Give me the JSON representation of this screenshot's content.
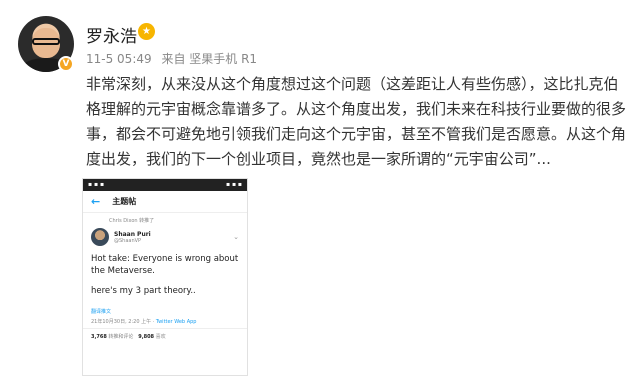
{
  "post": {
    "username": "罗永浩",
    "time": "11-5 05:49",
    "source": "来自 坚果手机 R1",
    "body": "非常深刻，从来没从这个角度想过这个问题（这差距让人有些伤感），这比扎克伯格理解的元宇宙概念靠谱多了。从这个角度出发，我们未来在科技行业要做的很多事，都会不可避免地引领我们走向这个元宇宙，甚至不管我们是否愿意。从这个角度出发，我们的下一个创业项目，竟然也是一家所谓的“元宇宙公司”..."
  },
  "embedded": {
    "header_title": "主题帖",
    "retweet_note": "Chris Dixon 转推了",
    "author_name": "Shaan Puri",
    "author_handle": "@ShaanVP",
    "text_line1": "Hot take: Everyone is wrong about the Metaverse.",
    "text_line2": "here's my 3 part theory..",
    "translate_link": "翻译推文",
    "timestamp": "21年10月30日, 2:20 上午 · ",
    "app": "Twitter Web App",
    "retweets": "3,768",
    "retweets_label": "转推和评论",
    "likes": "9,808",
    "likes_label": "喜欢"
  },
  "icons": [
    "verified-badge-icon",
    "medal-icon",
    "back-arrow-icon",
    "chevron-down-icon"
  ]
}
